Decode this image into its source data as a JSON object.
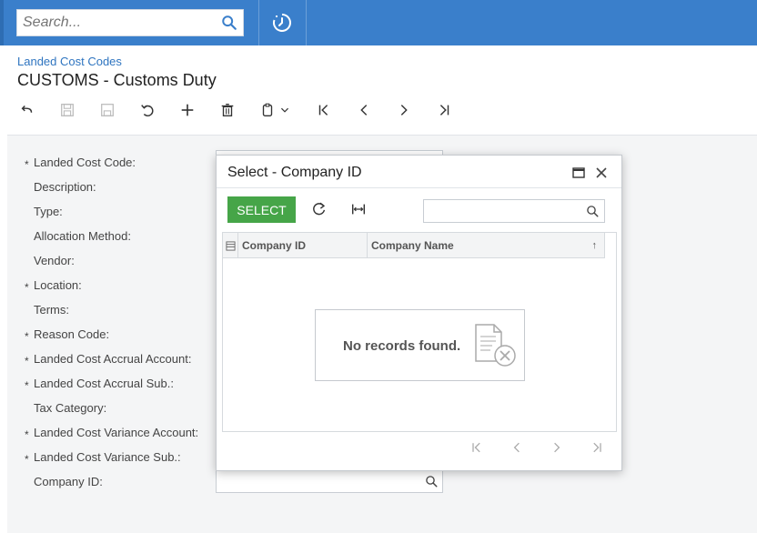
{
  "topbar": {
    "search_placeholder": "Search..."
  },
  "header": {
    "breadcrumb": "Landed Cost Codes",
    "title": "CUSTOMS - Customs Duty"
  },
  "form": {
    "fields": [
      {
        "label": "Landed Cost Code:",
        "required": true
      },
      {
        "label": "Description:",
        "required": false
      },
      {
        "label": "Type:",
        "required": false
      },
      {
        "label": "Allocation Method:",
        "required": false
      },
      {
        "label": "Vendor:",
        "required": false
      },
      {
        "label": "Location:",
        "required": true
      },
      {
        "label": "Terms:",
        "required": false
      },
      {
        "label": "Reason Code:",
        "required": true
      },
      {
        "label": "Landed Cost Accrual Account:",
        "required": true
      },
      {
        "label": "Landed Cost Accrual Sub.:",
        "required": true
      },
      {
        "label": "Tax Category:",
        "required": false
      },
      {
        "label": "Landed Cost Variance Account:",
        "required": true
      },
      {
        "label": "Landed Cost Variance Sub.:",
        "required": true
      },
      {
        "label": "Company ID:",
        "required": false
      }
    ],
    "required_marker": "*"
  },
  "dialog": {
    "title": "Select - Company ID",
    "select_label": "SELECT",
    "columns": [
      "Company ID",
      "Company Name"
    ],
    "sort_indicator": "↑",
    "empty_message": "No records found."
  },
  "colors": {
    "topbar": "#3a7fcb",
    "select_button": "#46a548",
    "link": "#2f75c0"
  }
}
